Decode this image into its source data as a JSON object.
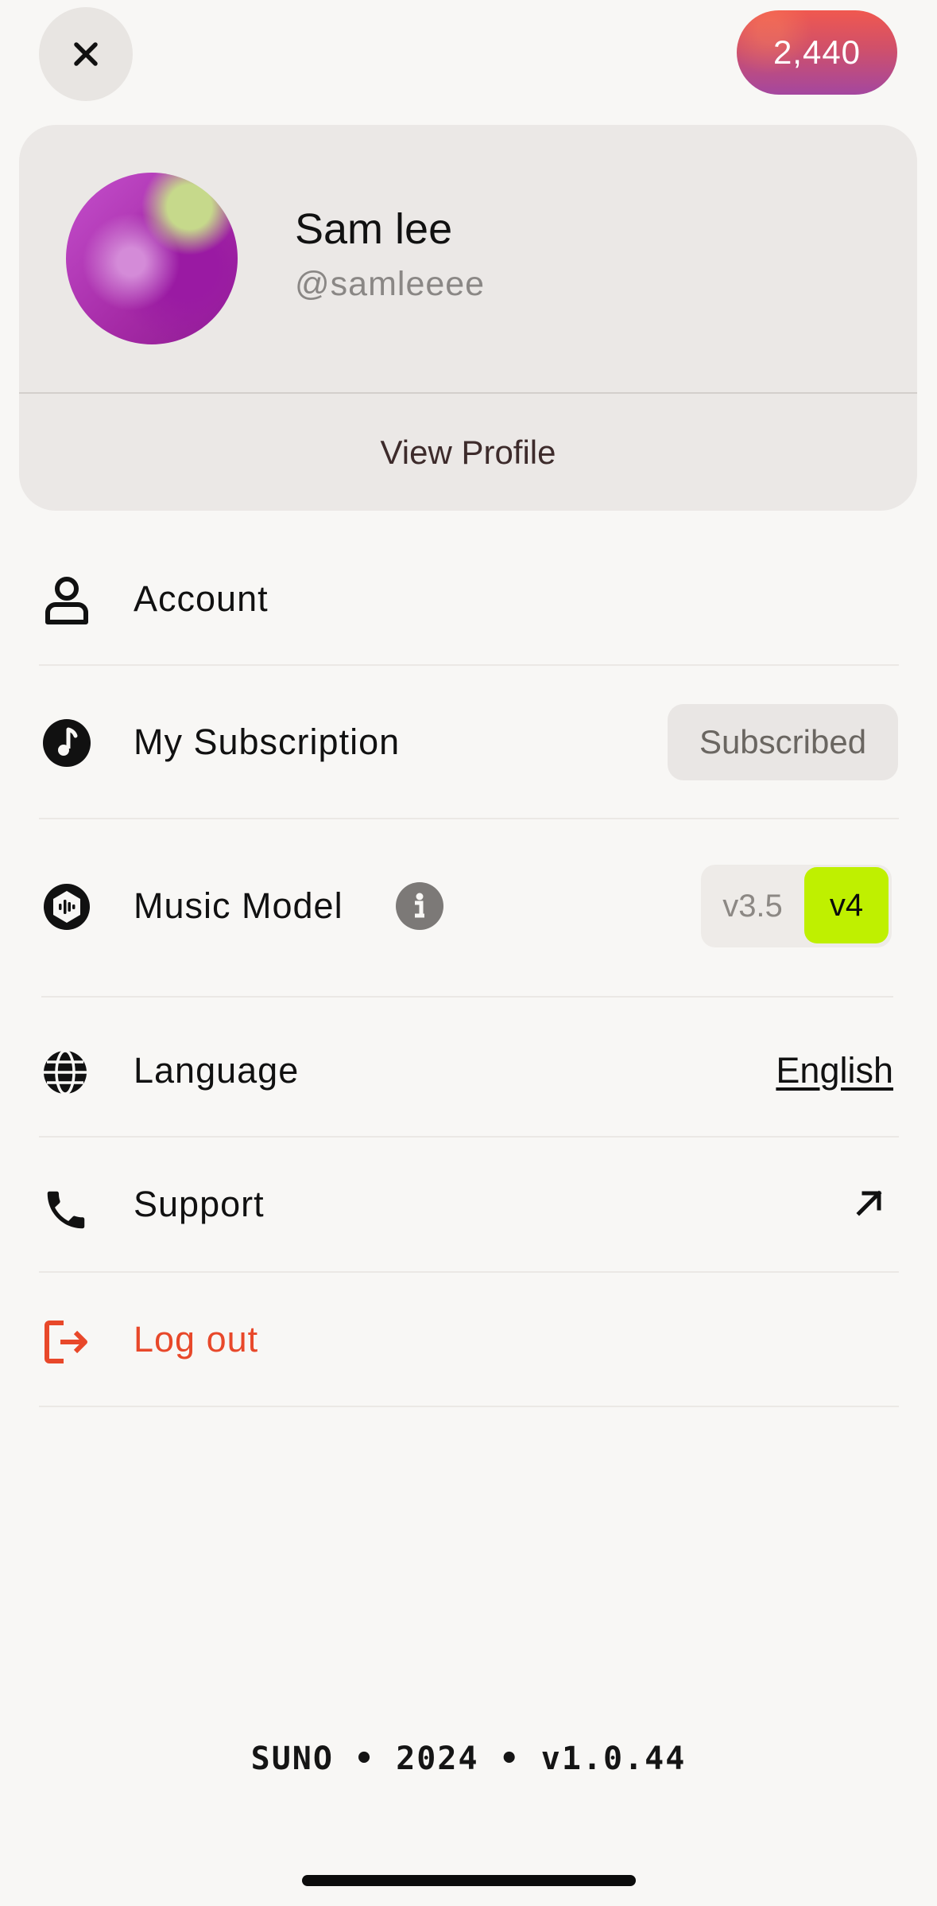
{
  "top_bar": {
    "close_icon": "close-icon",
    "credits": "2,440"
  },
  "profile": {
    "name": "Sam lee",
    "handle": "@samleeee",
    "view_profile_label": "View Profile"
  },
  "menu": {
    "account": {
      "label": "Account",
      "icon": "user-icon"
    },
    "subscription": {
      "label": "My Subscription",
      "icon": "music-note-icon",
      "badge": "Subscribed"
    },
    "music_model": {
      "label": "Music Model",
      "icon": "waveform-icon",
      "info_icon": "info-icon",
      "options": [
        "v3.5",
        "v4"
      ],
      "selected": "v4"
    },
    "language": {
      "label": "Language",
      "icon": "globe-icon",
      "value": "English"
    },
    "support": {
      "label": "Support",
      "icon": "phone-icon",
      "action_icon": "external-arrow-icon"
    },
    "logout": {
      "label": "Log out",
      "icon": "logout-icon"
    }
  },
  "footer": {
    "text": "SUNO • 2024 • v1.0.44"
  },
  "colors": {
    "background": "#f8f7f5",
    "card": "#ebe8e6",
    "accent_green": "#bff000",
    "logout_red": "#e8482a",
    "credits_gradient_top": "#f0584f",
    "credits_gradient_bottom": "#a4479f"
  }
}
